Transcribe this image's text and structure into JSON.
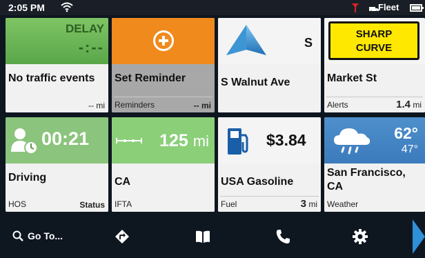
{
  "status_bar": {
    "time": "2:05 PM",
    "fleet_label": "Fleet"
  },
  "tiles": {
    "traffic": {
      "delay_label": "DELAY",
      "delay_value": "-:--",
      "title": "No traffic events",
      "distance": "-- mi"
    },
    "reminder": {
      "title": "Set Reminder",
      "label": "Reminders",
      "distance": "-- mi"
    },
    "navigation": {
      "heading": "S",
      "title": "S Walnut Ave"
    },
    "alert": {
      "sign_line1": "SHARP",
      "sign_line2": "CURVE",
      "title": "Market St",
      "label": "Alerts",
      "distance_value": "1.4",
      "distance_unit": "mi"
    },
    "hos": {
      "time": "00:21",
      "title": "Driving",
      "label": "HOS",
      "status": "Status"
    },
    "ifta": {
      "distance_value": "125",
      "distance_unit": "mi",
      "title": "CA",
      "label": "IFTA"
    },
    "fuel": {
      "price": "$3.84",
      "title": "USA Gasoline",
      "label": "Fuel",
      "distance_value": "3",
      "distance_unit": "mi"
    },
    "weather": {
      "temp_high": "62°",
      "temp_low": "47°",
      "title": "San Francisco, CA",
      "label": "Weather"
    }
  },
  "navbar": {
    "goto_label": "Go To..."
  },
  "icons": {
    "wifi": "wifi-icon",
    "signal": "signal-icon",
    "fleet": "fleet-icon",
    "battery": "battery-icon",
    "plus": "plus-circle-icon",
    "nav_arrow": "navigation-arrow-icon",
    "driver": "driver-clock-icon",
    "ruler": "distance-ruler-icon",
    "fuel": "fuel-pump-icon",
    "weather": "rain-cloud-icon",
    "search": "search-icon",
    "route": "route-icon",
    "book": "book-icon",
    "phone": "phone-icon",
    "gear": "gear-icon",
    "next": "chevron-right-icon"
  },
  "colors": {
    "traffic_green": "#59a74a",
    "reminder_orange": "#f08a1c",
    "sign_yellow": "#ffe800",
    "hos_green": "#8bc47c",
    "ifta_green": "#8bcf79",
    "weather_blue": "#3b7bbd",
    "accent_blue": "#2f8fd8"
  }
}
